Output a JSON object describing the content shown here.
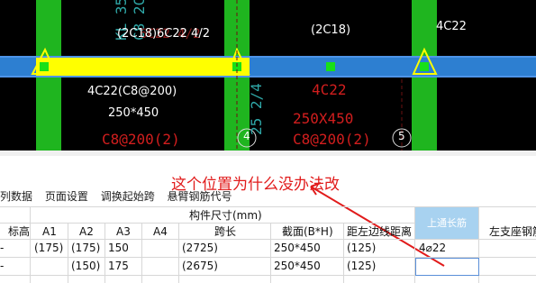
{
  "cad": {
    "background": "#000000",
    "beam_color": "#ffff00",
    "column_color": "#1fb51f",
    "support_color": "#2d7fd1",
    "labels": {
      "beam_top_left": "(2C18)6C22 4/2",
      "beam_top_mid": "(2C18)",
      "beam_top_right": "4C22",
      "left_rebar": "4C22(C8@200)",
      "left_section": "250*450",
      "mid_rebar": "4C22",
      "mid_section": "250X450",
      "mid_stirrup": "C8@200(2)",
      "left_stirrup_partial": "C8@200(2)",
      "axis_4": "4",
      "axis_5": "5"
    }
  },
  "toolbar": {
    "items": [
      "列数据",
      "页面设置",
      "调换起始跨",
      "悬臂钢筋代号"
    ]
  },
  "annotation": {
    "text": "这个位置为什么没办法改",
    "color": "#e11b1b"
  },
  "table": {
    "group_header": "构件尺寸(mm)",
    "columns": {
      "elev": "标高",
      "a1": "A1",
      "a2": "A2",
      "a3": "A3",
      "a4": "A4",
      "span": "跨长",
      "section": "截面(B*H)",
      "left_dist": "距左边线距离",
      "top_bar": "上通长筋",
      "left_support": "左支座钢筋"
    },
    "rows": [
      {
        "elev": "-",
        "a1": "(175)",
        "a2": "(175)",
        "a3": "150",
        "a4": "",
        "span": "(2725)",
        "section": "250*450",
        "left_dist": "(125)",
        "top_bar": "4⌀22",
        "left_support": ""
      },
      {
        "elev": "-",
        "a1": "",
        "a2": "(150)",
        "a3": "175",
        "a4": "",
        "span": "(2675)",
        "section": "250*450",
        "left_dist": "(125)",
        "top_bar": "",
        "left_support": ""
      }
    ],
    "highlight_color": "#a8d2f0"
  }
}
